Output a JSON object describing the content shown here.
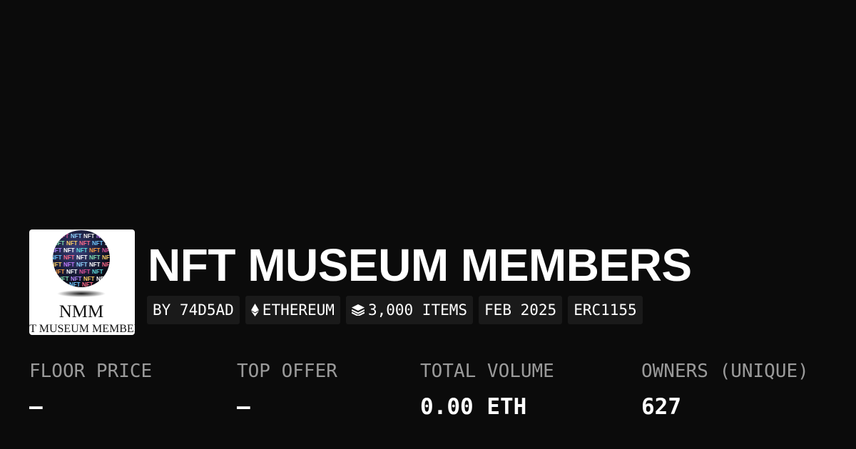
{
  "collection": {
    "name": "NFT MUSEUM MEMBERS",
    "logo": {
      "globe_text": "NFT",
      "initials": "NMM",
      "full_name": "NFT MUSEUM MEMBERS"
    }
  },
  "tags": [
    {
      "label": "BY 74D5AD",
      "icon": null
    },
    {
      "label": "ETHEREUM",
      "icon": "ethereum-icon"
    },
    {
      "label": "3,000 ITEMS",
      "icon": "layers-icon"
    },
    {
      "label": "FEB 2025",
      "icon": null
    },
    {
      "label": "ERC1155",
      "icon": null
    }
  ],
  "stats": [
    {
      "label": "FLOOR PRICE",
      "value": "–"
    },
    {
      "label": "TOP OFFER",
      "value": "–"
    },
    {
      "label": "TOTAL VOLUME",
      "value": "0.00 ETH"
    },
    {
      "label": "OWNERS (UNIQUE)",
      "value": "627"
    }
  ],
  "colors": {
    "background": "#0b0b0b",
    "tag_background": "#1a1a1a",
    "label": "#9a9a9a",
    "text": "#ffffff"
  }
}
